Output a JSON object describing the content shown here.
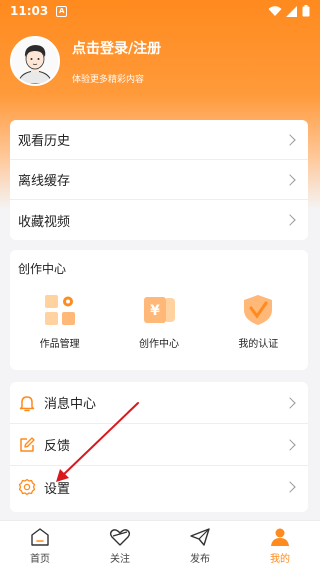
{
  "status_bar": {
    "time": "11:03",
    "badge": "A"
  },
  "profile": {
    "login_label": "点击登录/注册",
    "subtitle": "体验更多精彩内容"
  },
  "menu": {
    "items": [
      {
        "label": "观看历史"
      },
      {
        "label": "离线缓存"
      },
      {
        "label": "收藏视频"
      }
    ]
  },
  "creator": {
    "title": "创作中心",
    "items": [
      {
        "label": "作品管理",
        "icon": "works-grid-icon"
      },
      {
        "label": "创作中心",
        "icon": "yen-cards-icon"
      },
      {
        "label": "我的认证",
        "icon": "certified-shield-icon"
      }
    ]
  },
  "settings": {
    "items": [
      {
        "label": "消息中心",
        "icon": "bell-icon"
      },
      {
        "label": "反馈",
        "icon": "edit-icon"
      },
      {
        "label": "设置",
        "icon": "gear-icon"
      }
    ]
  },
  "tabbar": {
    "items": [
      {
        "label": "首页",
        "icon": "home-icon"
      },
      {
        "label": "关注",
        "icon": "heart-icon"
      },
      {
        "label": "发布",
        "icon": "send-icon"
      },
      {
        "label": "我的",
        "icon": "person-icon",
        "active": true
      }
    ]
  },
  "colors": {
    "accent": "#ff8a1e",
    "arrow": "#d9191e"
  }
}
